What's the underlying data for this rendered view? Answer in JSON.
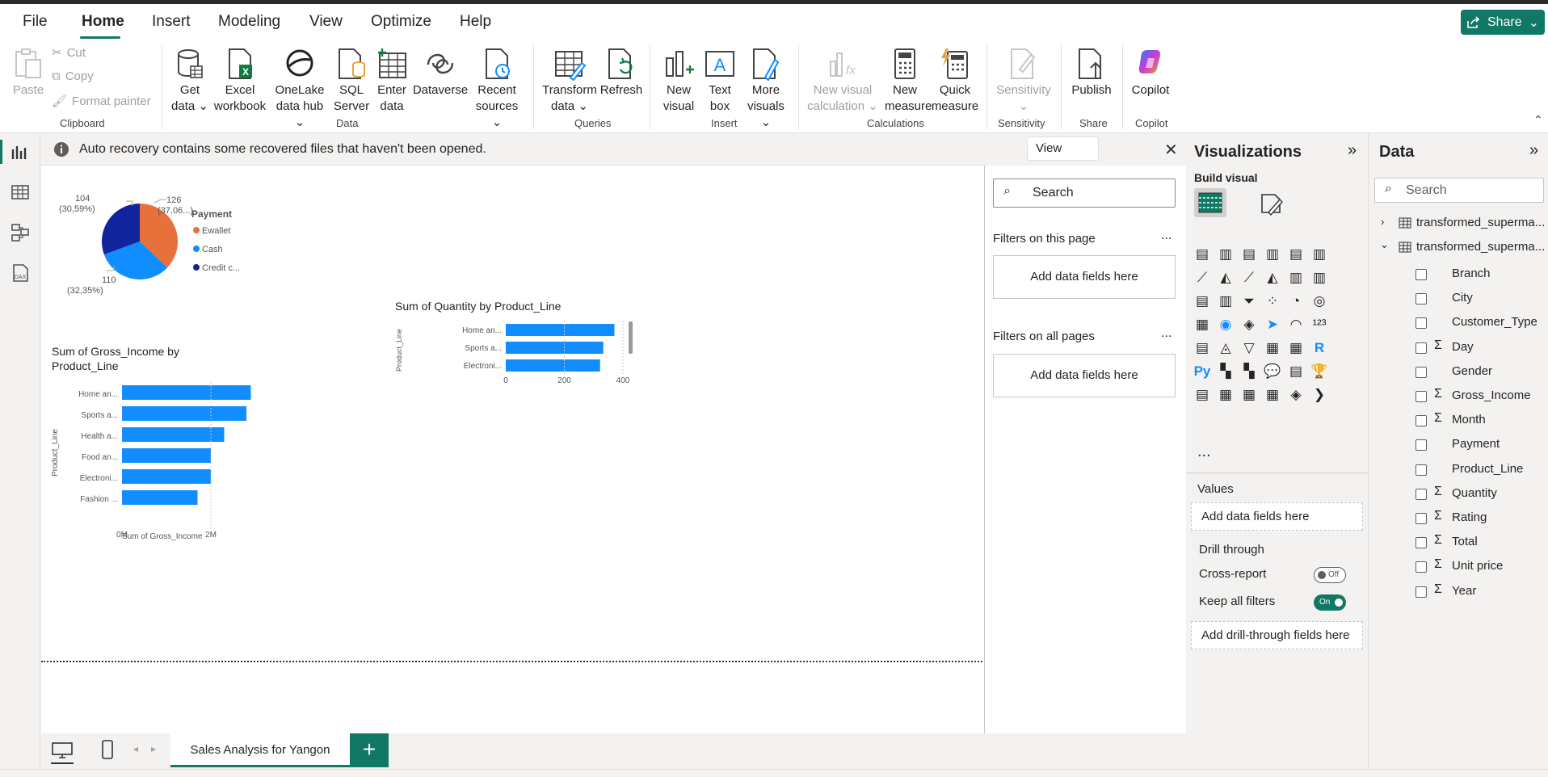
{
  "menu": {
    "items": [
      "File",
      "Home",
      "Insert",
      "Modeling",
      "View",
      "Optimize",
      "Help"
    ],
    "active": "Home",
    "share_label": "Share"
  },
  "ribbon": {
    "clipboard": {
      "paste": "Paste",
      "cut": "Cut",
      "copy": "Copy",
      "format_painter": "Format painter",
      "label": "Clipboard"
    },
    "data": {
      "get_data": [
        "Get",
        "data"
      ],
      "excel": [
        "Excel",
        "workbook"
      ],
      "onelake": [
        "OneLake",
        "data hub"
      ],
      "sql": [
        "SQL",
        "Server"
      ],
      "enter": [
        "Enter",
        "data"
      ],
      "dataverse": [
        "Dataverse",
        ""
      ],
      "recent": [
        "Recent",
        "sources"
      ],
      "label": "Data"
    },
    "queries": {
      "transform": [
        "Transform",
        "data"
      ],
      "refresh": [
        "Refresh",
        ""
      ],
      "label": "Queries"
    },
    "insert": {
      "new_visual": [
        "New",
        "visual"
      ],
      "text_box": [
        "Text",
        "box"
      ],
      "more_visuals": [
        "More",
        "visuals"
      ],
      "label": "Insert"
    },
    "calculations": {
      "new_visual_calc": [
        "New visual",
        "calculation"
      ],
      "new_measure": [
        "New",
        "measure"
      ],
      "quick_measure": [
        "Quick",
        "measure"
      ],
      "label": "Calculations"
    },
    "sensitivity": {
      "btn": [
        "Sensitivity",
        ""
      ],
      "label": "Sensitivity"
    },
    "share": {
      "publish": [
        "Publish",
        ""
      ],
      "label": "Share"
    },
    "copilot": {
      "btn": [
        "Copilot",
        ""
      ],
      "label": "Copilot"
    }
  },
  "notification": {
    "text": "Auto recovery contains some recovered files that haven't been opened.",
    "button": "View recovered files"
  },
  "visuals": {
    "pie": {
      "legend_title": "Payment",
      "legend": [
        "Ewallet",
        "Cash",
        "Credit c..."
      ],
      "labels": [
        {
          "value": "126",
          "pct": "(37,06...)"
        },
        {
          "value": "110",
          "pct": "(32,35%)"
        },
        {
          "value": "104",
          "pct": "(30,59%)"
        }
      ]
    },
    "gross": {
      "title_line1": "Sum of Gross_Income by",
      "title_line2": "Product_Line",
      "ylabel": "Product_Line",
      "xlabel": "Sum of Gross_Income",
      "ticks": [
        "0M",
        "2M"
      ]
    },
    "quantity": {
      "title": "Sum of Quantity by Product_Line",
      "ylabel": "Product_Line",
      "ticks": [
        "0",
        "200",
        "400"
      ]
    }
  },
  "chart_data": [
    {
      "type": "pie",
      "legend_title": "Payment",
      "categories": [
        "Ewallet",
        "Cash",
        "Credit c..."
      ],
      "values": [
        126,
        110,
        104
      ],
      "colors": [
        "#e8703a",
        "#118dff",
        "#12239e"
      ]
    },
    {
      "type": "bar",
      "orientation": "horizontal",
      "title": "Sum of Gross_Income by Product_Line",
      "xlabel": "Sum of Gross_Income",
      "ylabel": "Product_Line",
      "categories": [
        "Home an...",
        "Sports a...",
        "Health a...",
        "Food an...",
        "Electroni...",
        "Fashion ..."
      ],
      "values": [
        2.9,
        2.8,
        2.3,
        2.0,
        2.0,
        1.7
      ],
      "xlim": [
        0,
        3
      ],
      "tick_labels": [
        "0M",
        "2M"
      ],
      "color": "#118dff"
    },
    {
      "type": "bar",
      "orientation": "horizontal",
      "title": "Sum of Quantity by Product_Line",
      "ylabel": "Product_Line",
      "categories": [
        "Home an...",
        "Sports a...",
        "Electroni..."
      ],
      "values": [
        371,
        333,
        322
      ],
      "xlim": [
        0,
        400
      ],
      "tick_labels": [
        "0",
        "200",
        "400"
      ],
      "color": "#118dff"
    }
  ],
  "filters": {
    "search_placeholder": "Search",
    "on_page": "Filters on this page",
    "on_all": "Filters on all pages",
    "add_fields": "Add data fields here",
    "dots": "..."
  },
  "visualizations": {
    "title": "Visualizations",
    "build_visual": "Build visual",
    "more": "...",
    "values_label": "Values",
    "values_well": "Add data fields here",
    "drill_through": "Drill through",
    "cross_report": "Cross-report",
    "cross_report_state": "Off",
    "keep_filters": "Keep all filters",
    "keep_filters_state": "On",
    "drill_well": "Add drill-through fields here"
  },
  "data_pane": {
    "title": "Data",
    "search_placeholder": "Search",
    "tables": [
      "transformed_superma...",
      "transformed_superma..."
    ],
    "fields": [
      {
        "name": "Branch",
        "sigma": false
      },
      {
        "name": "City",
        "sigma": false
      },
      {
        "name": "Customer_Type",
        "sigma": false
      },
      {
        "name": "Day",
        "sigma": true
      },
      {
        "name": "Gender",
        "sigma": false
      },
      {
        "name": "Gross_Income",
        "sigma": true
      },
      {
        "name": "Month",
        "sigma": true
      },
      {
        "name": "Payment",
        "sigma": false
      },
      {
        "name": "Product_Line",
        "sigma": false
      },
      {
        "name": "Quantity",
        "sigma": true
      },
      {
        "name": "Rating",
        "sigma": true
      },
      {
        "name": "Total",
        "sigma": true
      },
      {
        "name": "Unit price",
        "sigma": true
      },
      {
        "name": "Year",
        "sigma": true
      }
    ]
  },
  "pages": {
    "tab": "Sales Analysis for Yangon",
    "add": "+"
  },
  "colors": {
    "accent": "#117865",
    "bar": "#118dff",
    "pie_orange": "#e8703a",
    "pie_dark": "#12239e"
  }
}
